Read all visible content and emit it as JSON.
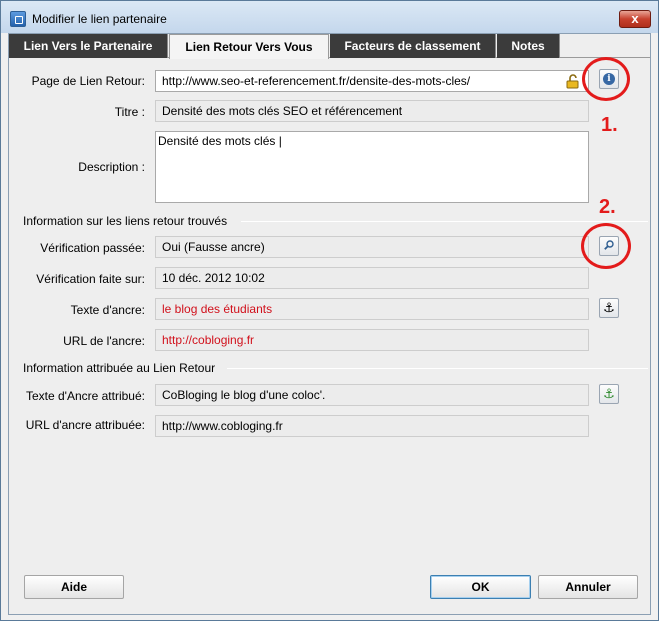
{
  "window": {
    "title": "Modifier le lien partenaire",
    "close_glyph": "x"
  },
  "tabs": [
    {
      "label": "Lien Vers le Partenaire",
      "active": false
    },
    {
      "label": "Lien Retour Vers Vous",
      "active": true
    },
    {
      "label": "Facteurs de classement",
      "active": false
    },
    {
      "label": "Notes",
      "active": false
    }
  ],
  "form": {
    "page_label": "Page de Lien Retour:",
    "page_value": "http://www.seo-et-referencement.fr/densite-des-mots-cles/",
    "titre_label": "Titre :",
    "titre_value": "Densité des mots clés SEO et référencement",
    "description_label": "Description :",
    "description_value": "Densité des mots clés |"
  },
  "section_found": {
    "title": "Information sur les liens retour trouvés",
    "verif_label": "Vérification passée:",
    "verif_value": "Oui (Fausse ancre)",
    "date_label": "Vérification faite sur:",
    "date_value": "10 déc. 2012 10:02",
    "anchor_text_label": "Texte d'ancre:",
    "anchor_text_value": "le blog des étudiants",
    "anchor_url_label": "URL de l'ancre:",
    "anchor_url_value": "http://cobloging.fr"
  },
  "section_attr": {
    "title": "Information attribuée au Lien Retour",
    "anchor_text_label": "Texte d'Ancre attribué:",
    "anchor_text_value": "CoBloging le blog d'une coloc'.",
    "anchor_url_label": "URL d'ancre attribuée:",
    "anchor_url_value": "http://www.cobloging.fr"
  },
  "annotations": {
    "one": "1.",
    "two": "2."
  },
  "buttons": {
    "help": "Aide",
    "ok": "OK",
    "cancel": "Annuler"
  },
  "icons": {
    "info": "info-icon",
    "search": "magnifier-icon",
    "anchor": "anchor-icon",
    "anchor_add": "anchor-add-icon",
    "lock": "lock-icon"
  },
  "colors": {
    "red_text": "#d1101b",
    "annotation": "#e31b1b",
    "active_tab_bg": "#f4f4f4",
    "inactive_tab_bg": "#3b3b3b"
  }
}
